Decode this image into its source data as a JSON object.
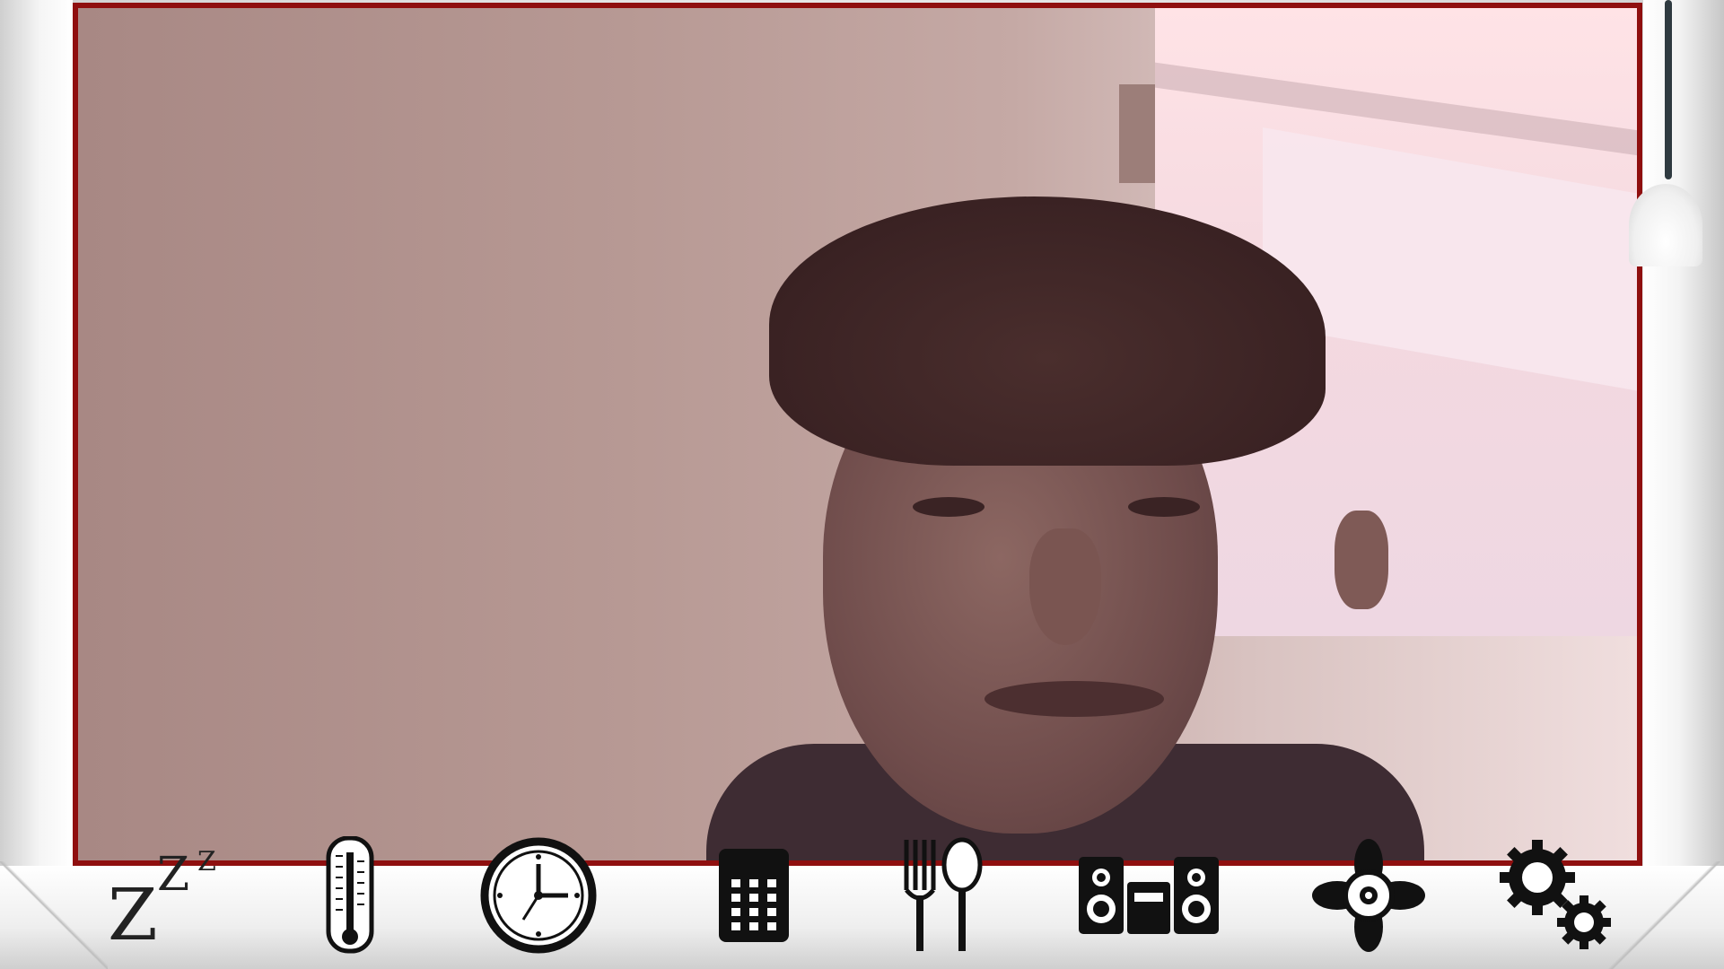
{
  "app": {
    "feed": "webcam",
    "accent_color": "#8f0f0f",
    "background_color": "#f2f2f2"
  },
  "overlay": {
    "pull_cord": "bell-pull-icon"
  },
  "toolbar": {
    "items": [
      {
        "icon": "sleep-zzz-icon",
        "glyph": "Z"
      },
      {
        "icon": "thermometer-icon"
      },
      {
        "icon": "clock-icon"
      },
      {
        "icon": "phone-keypad-icon"
      },
      {
        "icon": "fork-spoon-icon"
      },
      {
        "icon": "stereo-speakers-icon"
      },
      {
        "icon": "fan-icon"
      },
      {
        "icon": "settings-gears-icon"
      }
    ]
  }
}
